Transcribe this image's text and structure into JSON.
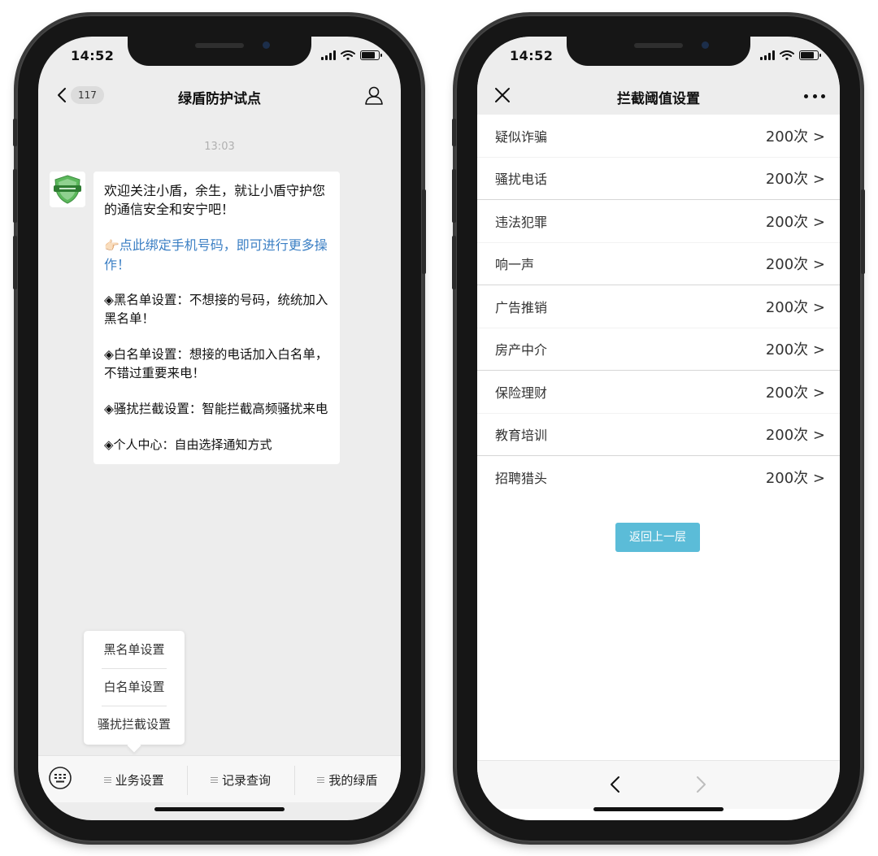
{
  "left_phone": {
    "status": {
      "time": "14:52"
    },
    "nav": {
      "badge": "117",
      "title": "绿盾防护试点"
    },
    "chat": {
      "timestamp": "13:03",
      "avatar_icon": "green-shield-logo",
      "message": {
        "intro": "欢迎关注小盾，余生，就让小盾守护您的通信安全和安宁吧！",
        "bind_link_prefix": "👉🏻",
        "bind_link": "点此绑定手机号码，即可进行更多操作！",
        "blacklist": "◈黑名单设置：不想接的号码，统统加入黑名单！",
        "whitelist": "◈白名单设置：想接的电话加入白名单，不错过重要来电！",
        "harass": "◈骚扰拦截设置：智能拦截高频骚扰来电",
        "personal": "◈个人中心：自由选择通知方式"
      }
    },
    "popup_menu": {
      "items": [
        {
          "label": "黑名单设置"
        },
        {
          "label": "白名单设置"
        },
        {
          "label": "骚扰拦截设置"
        }
      ]
    },
    "menubar": {
      "items": [
        {
          "label": "业务设置"
        },
        {
          "label": "记录查询"
        },
        {
          "label": "我的绿盾"
        }
      ]
    }
  },
  "right_phone": {
    "status": {
      "time": "14:52"
    },
    "nav": {
      "title": "拦截阈值设置"
    },
    "rows": [
      {
        "label": "疑似诈骗",
        "value": "200次 >"
      },
      {
        "label": "骚扰电话",
        "value": "200次 >"
      },
      {
        "label": "违法犯罪",
        "value": "200次 >"
      },
      {
        "label": "响一声",
        "value": "200次 >"
      },
      {
        "label": "广告推销",
        "value": "200次 >"
      },
      {
        "label": "房产中介",
        "value": "200次 >"
      },
      {
        "label": "保险理财",
        "value": "200次 >"
      },
      {
        "label": "教育培训",
        "value": "200次 >"
      },
      {
        "label": "招聘猎头",
        "value": "200次 >"
      }
    ],
    "back_button": "返回上一层"
  },
  "colors": {
    "link_blue": "#3b7fc4",
    "back_button_bg": "#5bbcd8",
    "chat_bg": "#ededed",
    "shield_green": "#4caf50"
  }
}
